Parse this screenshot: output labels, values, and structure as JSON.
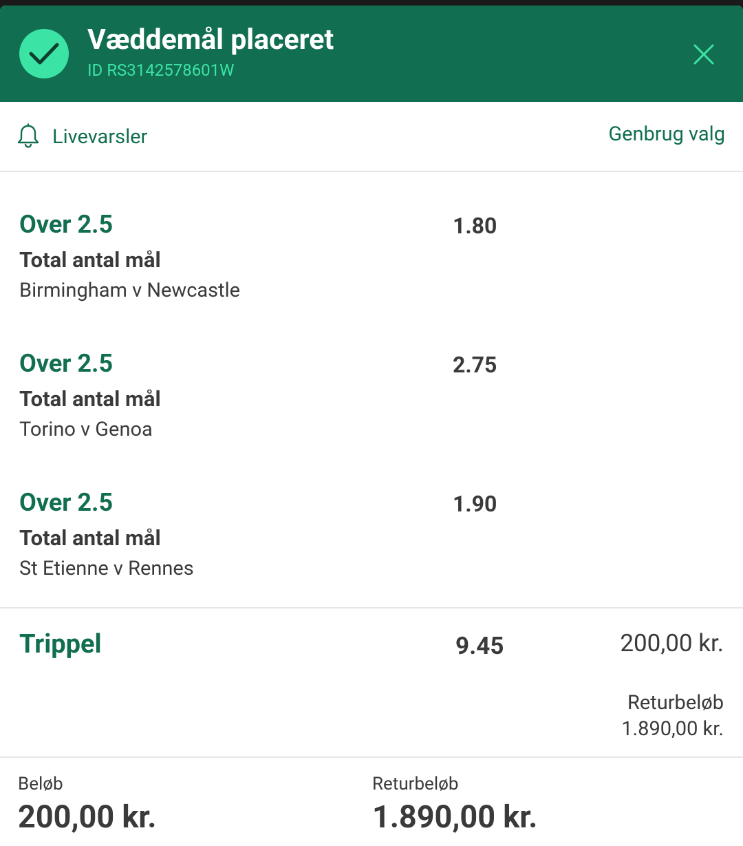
{
  "header": {
    "title": "Væddemål placeret",
    "bet_id": "ID RS3142578601W",
    "check_icon": "check-icon",
    "close_icon": "close-icon"
  },
  "toolbar": {
    "live_alerts_label": "Livevarsler",
    "bell_icon": "bell-icon",
    "reuse_label": "Genbrug valg"
  },
  "selections": [
    {
      "market": "Over 2.5",
      "type": "Total antal mål",
      "event": "Birmingham v Newcastle",
      "odds": "1.80"
    },
    {
      "market": "Over 2.5",
      "type": "Total antal mål",
      "event": "Torino v Genoa",
      "odds": "2.75"
    },
    {
      "market": "Over 2.5",
      "type": "Total antal mål",
      "event": "St Etienne v Rennes",
      "odds": "1.90"
    }
  ],
  "summary": {
    "bet_type": "Trippel",
    "total_odds": "9.45",
    "stake": "200,00 kr.",
    "return_label": "Returbeløb",
    "return_value": "1.890,00 kr."
  },
  "footer": {
    "stake_label": "Beløb",
    "stake_value": "200,00 kr.",
    "return_label": "Returbeløb",
    "return_value": "1.890,00 kr."
  },
  "colors": {
    "brand_green": "#126e51",
    "accent_mint": "#3be3a5",
    "text_dark": "#3a3a3a"
  }
}
